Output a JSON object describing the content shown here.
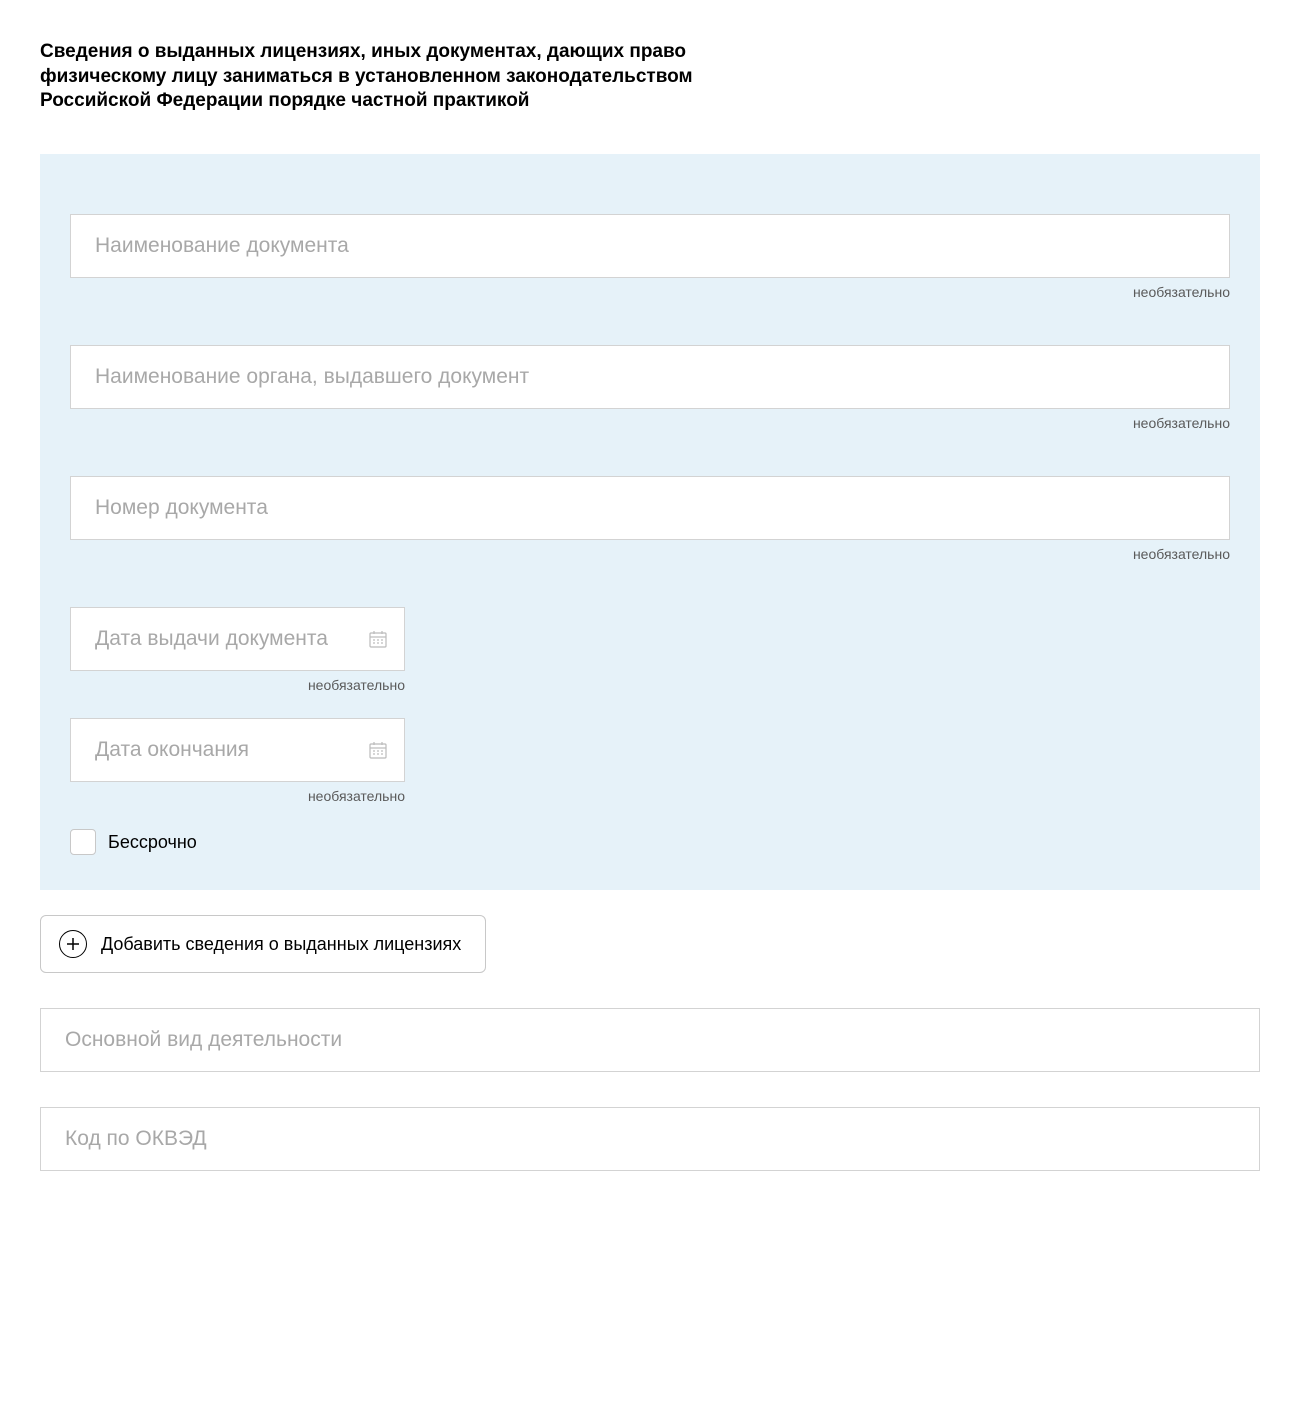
{
  "heading": "Сведения о выданных лицензиях, иных документах, дающих право физическому лицу заниматься в установленном законодательством Российской Федерации порядке частной практикой",
  "fields": {
    "docName": {
      "placeholder": "Наименование документа",
      "helper": "необязательно"
    },
    "issuer": {
      "placeholder": "Наименование органа, выдавшего документ",
      "helper": "необязательно"
    },
    "docNumber": {
      "placeholder": "Номер документа",
      "helper": "необязательно"
    },
    "issueDate": {
      "placeholder": "Дата выдачи документа",
      "helper": "необязательно"
    },
    "endDate": {
      "placeholder": "Дата окончания",
      "helper": "необязательно"
    },
    "perpetual": {
      "label": "Бессрочно"
    },
    "mainActivity": {
      "placeholder": "Основной вид деятельности"
    },
    "okvedCode": {
      "placeholder": "Код по ОКВЭД"
    }
  },
  "addButton": {
    "label": "Добавить сведения о выданных лицензиях"
  }
}
